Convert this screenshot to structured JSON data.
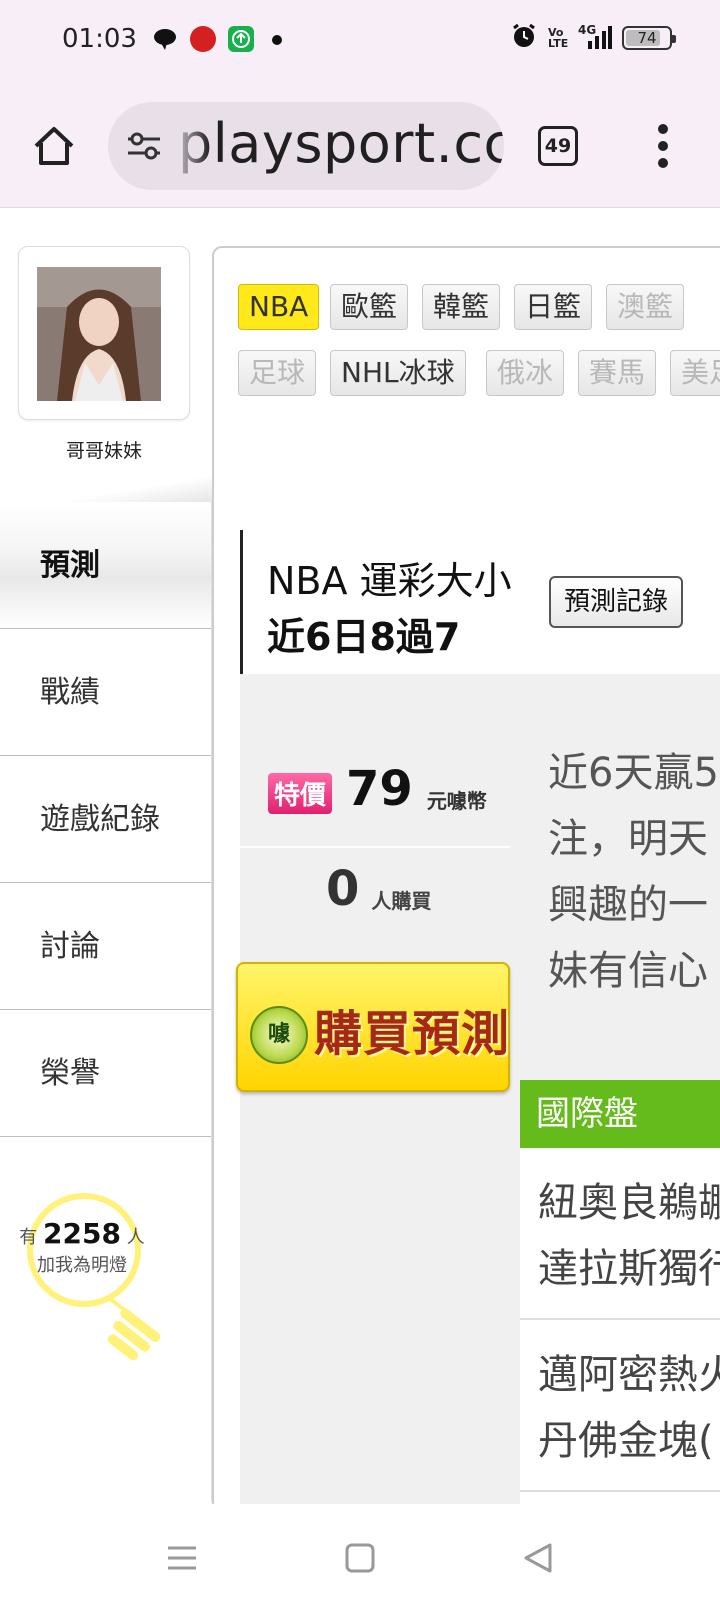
{
  "status_bar": {
    "time": "01:03",
    "network": "4G",
    "volte": "Vo LTE",
    "battery": "74",
    "battery_level_percent": 74,
    "icons": [
      "chat-bubble-icon",
      "red-app-icon",
      "green-upload-icon",
      "dot-icon",
      "alarm-icon",
      "volte-icon",
      "signal-icon",
      "battery-icon"
    ]
  },
  "browser": {
    "url": "playsport.cc",
    "tab_count": "49",
    "icons": [
      "home-icon",
      "site-settings-icon",
      "tab-switcher-icon",
      "overflow-menu-icon"
    ]
  },
  "profile": {
    "name": "哥哥妹妹"
  },
  "sidebar": {
    "items": [
      {
        "label": "預測",
        "active": true
      },
      {
        "label": "戰績",
        "active": false
      },
      {
        "label": "遊戲紀錄",
        "active": false
      },
      {
        "label": "討論",
        "active": false
      },
      {
        "label": "榮譽",
        "active": false
      }
    ]
  },
  "fans": {
    "prefix": "有",
    "count": "2258",
    "suffix": "人",
    "caption": "加我為明燈"
  },
  "sport_tags": {
    "row1": [
      "NBA",
      "歐籃",
      "韓籃",
      "日籃",
      "澳籃"
    ],
    "row2": [
      "足球",
      "NHL冰球",
      "俄冰",
      "賽馬",
      "美足"
    ]
  },
  "prediction": {
    "title": "NBA 運彩大小",
    "record": "近6日8過7",
    "record_button": "預測記錄",
    "badge": "特價",
    "price": "79",
    "price_unit": "元噱幣",
    "buyers": "0",
    "buyers_label": "人購買",
    "buy_button": "購買預測",
    "coin_char": "噱"
  },
  "description": {
    "lines": [
      "近6天贏5",
      "注，明天",
      "興趣的一",
      "妹有信心"
    ]
  },
  "odds": {
    "header": "國際盤",
    "rows": [
      {
        "line1": "紐奧良鵜鶘",
        "line2": "達拉斯獨行"
      },
      {
        "line1": "邁阿密熱火",
        "line2": "丹佛金塊("
      }
    ]
  },
  "colors": {
    "browser_bg": "#f7eef8",
    "selected_tag": "#ffe91a",
    "badge": "#e0206f",
    "buy_button": "#ffd400",
    "odds_header": "#66bb1c",
    "bulb": "#fff176"
  }
}
